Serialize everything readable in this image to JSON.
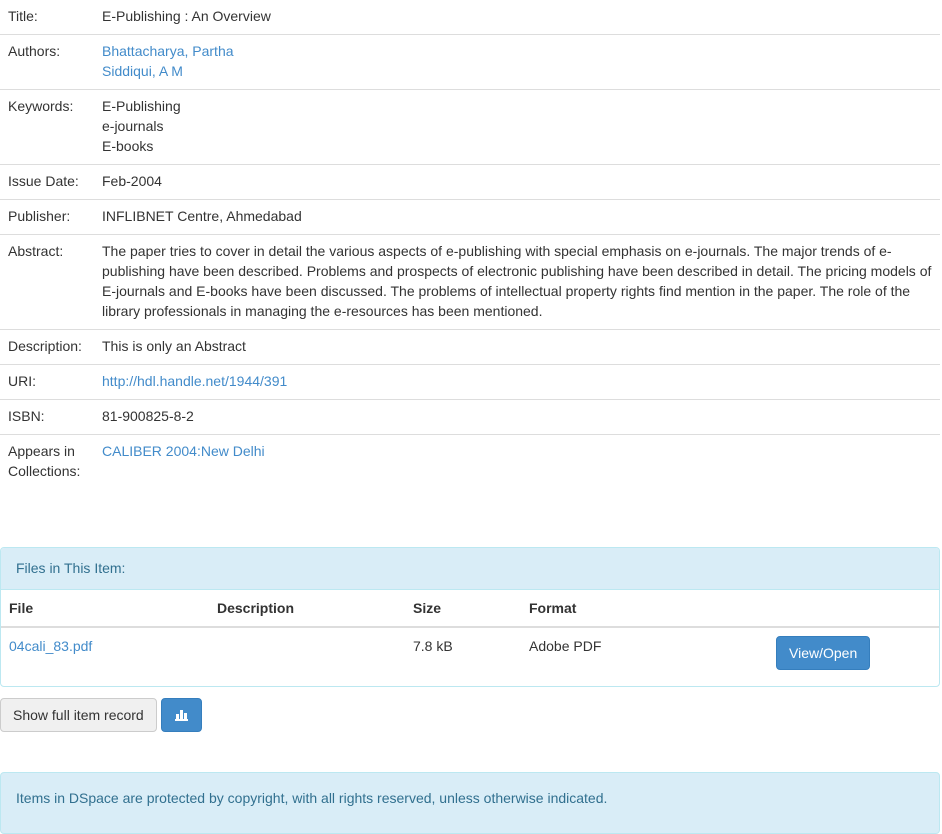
{
  "metadata": {
    "title": {
      "label": "Title:",
      "value": "E-Publishing : An Overview"
    },
    "authors": {
      "label": "Authors:",
      "values": [
        "Bhattacharya, Partha",
        "Siddiqui, A M"
      ]
    },
    "keywords": {
      "label": "Keywords:",
      "values": [
        "E-Publishing",
        "e-journals",
        "E-books"
      ]
    },
    "issue_date": {
      "label": "Issue Date:",
      "value": "Feb-2004"
    },
    "publisher": {
      "label": "Publisher:",
      "value": "INFLIBNET Centre, Ahmedabad"
    },
    "abstract": {
      "label": "Abstract:",
      "value": "The paper tries to cover in detail the various aspects of e-publishing with special emphasis on e-journals. The major trends of e-publishing have been described. Problems and prospects of electronic publishing have been described in detail. The pricing models of E-journals and E-books have been discussed. The problems of intellectual property rights find mention in the paper. The role of the library professionals in managing the e-resources has been mentioned."
    },
    "description": {
      "label": "Description:",
      "value": "This is only an Abstract"
    },
    "uri": {
      "label": "URI:",
      "value": "http://hdl.handle.net/1944/391"
    },
    "isbn": {
      "label": "ISBN:",
      "value": "81-900825-8-2"
    },
    "collections": {
      "label": "Appears in Collections:",
      "value": "CALIBER 2004:New Delhi"
    }
  },
  "files": {
    "heading": "Files in This Item:",
    "columns": {
      "file": "File",
      "description": "Description",
      "size": "Size",
      "format": "Format"
    },
    "rows": [
      {
        "file": "04cali_83.pdf",
        "description": "",
        "size": "7.8 kB",
        "format": "Adobe PDF",
        "action": "View/Open"
      }
    ]
  },
  "actions": {
    "show_full_record": "Show full item record",
    "stats_icon": "bar-chart-icon"
  },
  "footer": {
    "copyright": "Items in DSpace are protected by copyright, with all rights reserved, unless otherwise indicated."
  },
  "colors": {
    "link": "#428bca",
    "primary_button": "#428bca",
    "info_panel_bg": "#d9edf7",
    "info_panel_text": "#31708f"
  }
}
